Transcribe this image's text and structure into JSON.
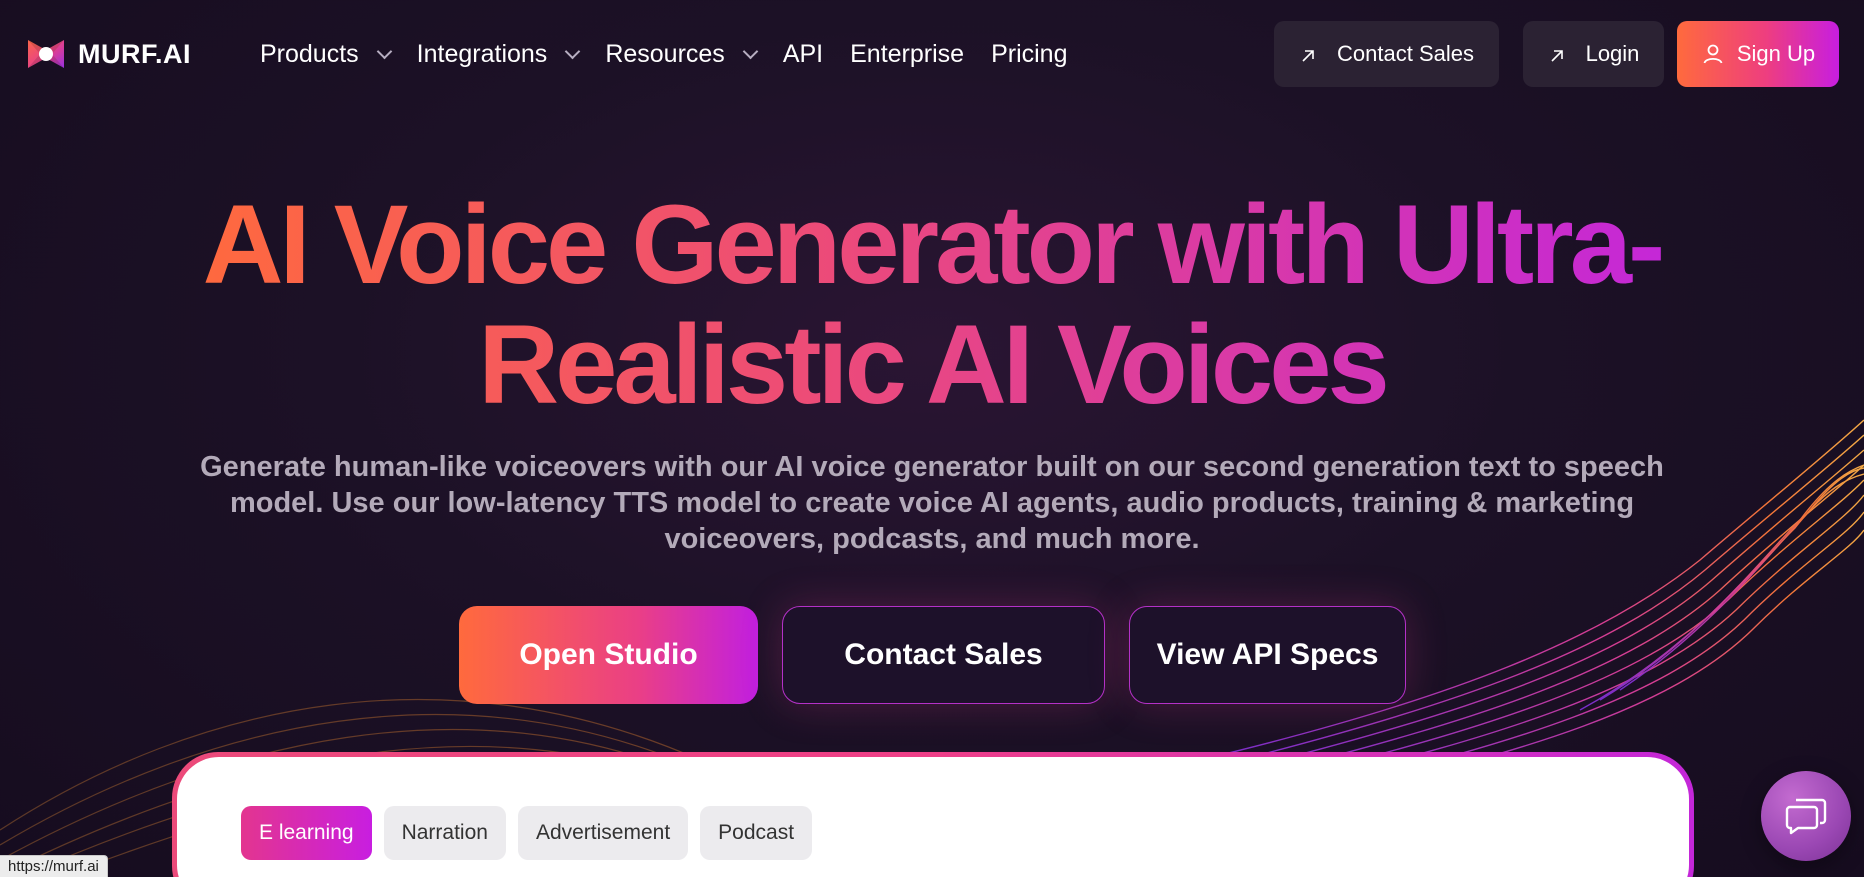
{
  "brand": {
    "name": "MURF.AI"
  },
  "nav": {
    "items": [
      {
        "label": "Products",
        "dropdown": true
      },
      {
        "label": "Integrations",
        "dropdown": true
      },
      {
        "label": "Resources",
        "dropdown": true
      },
      {
        "label": "API",
        "dropdown": false
      },
      {
        "label": "Enterprise",
        "dropdown": false
      },
      {
        "label": "Pricing",
        "dropdown": false
      }
    ],
    "contact_sales": "Contact Sales",
    "login": "Login",
    "signup": "Sign Up"
  },
  "hero": {
    "headline_line1": "AI Voice Generator with Ultra-",
    "headline_line2": "Realistic AI Voices",
    "subheading": "Generate human-like voiceovers with our AI voice generator built on our second generation text to speech model. Use our low-latency TTS model to create voice AI agents, audio products, training & marketing voiceovers, podcasts, and much more.",
    "cta_primary": "Open Studio",
    "cta_sales": "Contact Sales",
    "cta_api": "View API Specs"
  },
  "demo": {
    "tabs": [
      {
        "label": "E learning",
        "active": true
      },
      {
        "label": "Narration",
        "active": false
      },
      {
        "label": "Advertisement",
        "active": false
      },
      {
        "label": "Podcast",
        "active": false
      }
    ]
  },
  "status_bar": {
    "url": "https://murf.ai"
  },
  "icons": [
    "murf-logo-icon",
    "chevron-down-icon",
    "arrow-up-right-icon",
    "user-icon",
    "chat-icon"
  ],
  "colors": {
    "accent_orange": "#ff6a3d",
    "accent_pink": "#ec4a7a",
    "accent_purple": "#c427d9",
    "background": "#1c1126"
  }
}
